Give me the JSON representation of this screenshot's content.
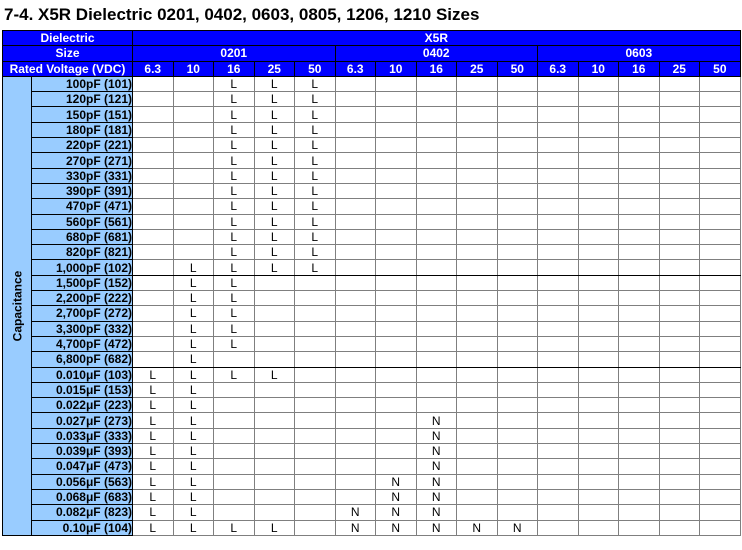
{
  "title": "7-4. X5R Dielectric 0201, 0402, 0603, 0805, 1206, 1210 Sizes",
  "header": {
    "dielectric_label": "Dielectric",
    "dielectric_value": "X5R",
    "size_label": "Size",
    "sizes": [
      "0201",
      "0402",
      "0603"
    ],
    "voltage_label": "Rated Voltage (VDC)",
    "voltages": [
      "6.3",
      "10",
      "16",
      "25",
      "50"
    ]
  },
  "capacitance_label": "Capacitance",
  "rows": [
    {
      "label": "100pF  (101)",
      "cells": [
        "",
        "",
        "L",
        "L",
        "L",
        "",
        "",
        "",
        "",
        "",
        "",
        "",
        "",
        "",
        ""
      ]
    },
    {
      "label": "120pF  (121)",
      "cells": [
        "",
        "",
        "L",
        "L",
        "L",
        "",
        "",
        "",
        "",
        "",
        "",
        "",
        "",
        "",
        ""
      ]
    },
    {
      "label": "150pF  (151)",
      "cells": [
        "",
        "",
        "L",
        "L",
        "L",
        "",
        "",
        "",
        "",
        "",
        "",
        "",
        "",
        "",
        ""
      ]
    },
    {
      "label": "180pF  (181)",
      "cells": [
        "",
        "",
        "L",
        "L",
        "L",
        "",
        "",
        "",
        "",
        "",
        "",
        "",
        "",
        "",
        ""
      ]
    },
    {
      "label": "220pF  (221)",
      "cells": [
        "",
        "",
        "L",
        "L",
        "L",
        "",
        "",
        "",
        "",
        "",
        "",
        "",
        "",
        "",
        ""
      ]
    },
    {
      "label": "270pF  (271)",
      "cells": [
        "",
        "",
        "L",
        "L",
        "L",
        "",
        "",
        "",
        "",
        "",
        "",
        "",
        "",
        "",
        ""
      ]
    },
    {
      "label": "330pF  (331)",
      "cells": [
        "",
        "",
        "L",
        "L",
        "L",
        "",
        "",
        "",
        "",
        "",
        "",
        "",
        "",
        "",
        ""
      ]
    },
    {
      "label": "390pF  (391)",
      "cells": [
        "",
        "",
        "L",
        "L",
        "L",
        "",
        "",
        "",
        "",
        "",
        "",
        "",
        "",
        "",
        ""
      ]
    },
    {
      "label": "470pF  (471)",
      "cells": [
        "",
        "",
        "L",
        "L",
        "L",
        "",
        "",
        "",
        "",
        "",
        "",
        "",
        "",
        "",
        ""
      ]
    },
    {
      "label": "560pF  (561)",
      "cells": [
        "",
        "",
        "L",
        "L",
        "L",
        "",
        "",
        "",
        "",
        "",
        "",
        "",
        "",
        "",
        ""
      ]
    },
    {
      "label": "680pF  (681)",
      "cells": [
        "",
        "",
        "L",
        "L",
        "L",
        "",
        "",
        "",
        "",
        "",
        "",
        "",
        "",
        "",
        ""
      ]
    },
    {
      "label": "820pF  (821)",
      "cells": [
        "",
        "",
        "L",
        "L",
        "L",
        "",
        "",
        "",
        "",
        "",
        "",
        "",
        "",
        "",
        ""
      ]
    },
    {
      "label": "1,000pF  (102)",
      "cells": [
        "",
        "L",
        "L",
        "L",
        "L",
        "",
        "",
        "",
        "",
        "",
        "",
        "",
        "",
        "",
        ""
      ]
    },
    {
      "label": "1,500pF  (152)",
      "cells": [
        "",
        "L",
        "L",
        "",
        "",
        "",
        "",
        "",
        "",
        "",
        "",
        "",
        "",
        "",
        ""
      ]
    },
    {
      "label": "2,200pF  (222)",
      "cells": [
        "",
        "L",
        "L",
        "",
        "",
        "",
        "",
        "",
        "",
        "",
        "",
        "",
        "",
        "",
        ""
      ]
    },
    {
      "label": "2,700pF  (272)",
      "cells": [
        "",
        "L",
        "L",
        "",
        "",
        "",
        "",
        "",
        "",
        "",
        "",
        "",
        "",
        "",
        ""
      ]
    },
    {
      "label": "3,300pF  (332)",
      "cells": [
        "",
        "L",
        "L",
        "",
        "",
        "",
        "",
        "",
        "",
        "",
        "",
        "",
        "",
        "",
        ""
      ]
    },
    {
      "label": "4,700pF  (472)",
      "cells": [
        "",
        "L",
        "L",
        "",
        "",
        "",
        "",
        "",
        "",
        "",
        "",
        "",
        "",
        "",
        ""
      ]
    },
    {
      "label": "6,800pF  (682)",
      "cells": [
        "",
        "L",
        "",
        "",
        "",
        "",
        "",
        "",
        "",
        "",
        "",
        "",
        "",
        "",
        ""
      ]
    },
    {
      "label": "0.010μF  (103)",
      "cells": [
        "L",
        "L",
        "L",
        "L",
        "",
        "",
        "",
        "",
        "",
        "",
        "",
        "",
        "",
        "",
        ""
      ]
    },
    {
      "label": "0.015μF  (153)",
      "cells": [
        "L",
        "L",
        "",
        "",
        "",
        "",
        "",
        "",
        "",
        "",
        "",
        "",
        "",
        "",
        ""
      ]
    },
    {
      "label": "0.022μF  (223)",
      "cells": [
        "L",
        "L",
        "",
        "",
        "",
        "",
        "",
        "",
        "",
        "",
        "",
        "",
        "",
        "",
        ""
      ]
    },
    {
      "label": "0.027μF  (273)",
      "cells": [
        "L",
        "L",
        "",
        "",
        "",
        "",
        "",
        "N",
        "",
        "",
        "",
        "",
        "",
        "",
        ""
      ]
    },
    {
      "label": "0.033μF  (333)",
      "cells": [
        "L",
        "L",
        "",
        "",
        "",
        "",
        "",
        "N",
        "",
        "",
        "",
        "",
        "",
        "",
        ""
      ]
    },
    {
      "label": "0.039μF  (393)",
      "cells": [
        "L",
        "L",
        "",
        "",
        "",
        "",
        "",
        "N",
        "",
        "",
        "",
        "",
        "",
        "",
        ""
      ]
    },
    {
      "label": "0.047μF  (473)",
      "cells": [
        "L",
        "L",
        "",
        "",
        "",
        "",
        "",
        "N",
        "",
        "",
        "",
        "",
        "",
        "",
        ""
      ]
    },
    {
      "label": "0.056μF  (563)",
      "cells": [
        "L",
        "L",
        "",
        "",
        "",
        "",
        "N",
        "N",
        "",
        "",
        "",
        "",
        "",
        "",
        ""
      ]
    },
    {
      "label": "0.068μF  (683)",
      "cells": [
        "L",
        "L",
        "",
        "",
        "",
        "",
        "N",
        "N",
        "",
        "",
        "",
        "",
        "",
        "",
        ""
      ]
    },
    {
      "label": "0.082μF  (823)",
      "cells": [
        "L",
        "L",
        "",
        "",
        "",
        "N",
        "N",
        "N",
        "",
        "",
        "",
        "",
        "",
        "",
        ""
      ]
    },
    {
      "label": "0.10μF  (104)",
      "cells": [
        "L",
        "L",
        "L",
        "L",
        "",
        "N",
        "N",
        "N",
        "N",
        "N",
        "",
        "",
        "",
        "",
        ""
      ]
    }
  ],
  "colors": {
    "header_bg": "#0000ff",
    "header_text": "#ffffff",
    "label_bg": "#99ccff"
  }
}
